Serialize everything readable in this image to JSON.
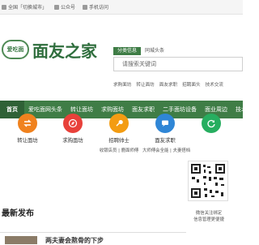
{
  "topbar": {
    "links": [
      "全国「切换城市」",
      "公众号",
      "手机访问"
    ]
  },
  "logo": {
    "badge_text": "爱吃面",
    "site_name": "面友之家"
  },
  "search": {
    "tabs": [
      "分类信息",
      "同城头条"
    ],
    "placeholder": "请搜索关键词",
    "hotwords": [
      "求购面坊",
      "转让面坊",
      "面友求职",
      "招聘面头",
      "技术交流"
    ]
  },
  "nav": {
    "items": [
      "首页",
      "爱吃面网头条",
      "转让面坊",
      "求购面坊",
      "面友求职",
      "二手面坊设备",
      "面业周边",
      "技术交流"
    ]
  },
  "categories": [
    {
      "label": "转让面坊",
      "sub": "",
      "icon": "arrows-icon",
      "color": "#f0821e"
    },
    {
      "label": "求购面坊",
      "sub": "",
      "icon": "compass-icon",
      "color": "#e8413a"
    },
    {
      "label": "招聘帅士",
      "sub": "收银店员 | 鹿面师傅",
      "icon": "wrench-icon",
      "color": "#f39c12"
    },
    {
      "label": "面友求职",
      "sub": "大师傅会全能 | 夫妻搭档",
      "icon": "chat-icon",
      "color": "#2f86d6"
    },
    {
      "label": "",
      "sub": "",
      "icon": "refresh-icon",
      "color": "#27ae60"
    }
  ],
  "qr": {
    "caption_line1": "微信关注绑定",
    "caption_line2": "信息管理更便捷"
  },
  "latest": {
    "title": "最新发布",
    "first_item": "两夫妻会熬骨的下步"
  }
}
